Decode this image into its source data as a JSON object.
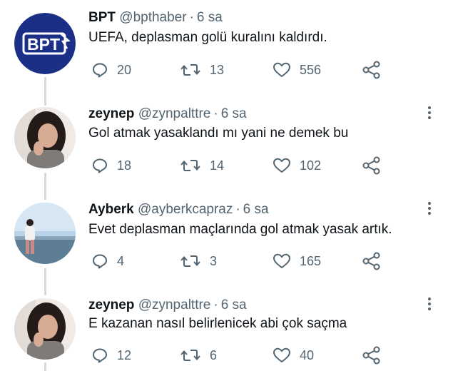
{
  "tweets": [
    {
      "name": "BPT",
      "handle": "@bpthaber",
      "dot": "·",
      "time": "6 sa",
      "text": "UEFA, deplasman golü kuralını kaldırdı.",
      "avatar_label": "BPT",
      "replies": "20",
      "retweets": "13",
      "likes": "556",
      "show_more": false
    },
    {
      "name": "zeynep",
      "handle": "@zynpalttre",
      "dot": "·",
      "time": "6 sa",
      "text": "Gol atmak yasaklandı mı yani ne demek bu",
      "replies": "18",
      "retweets": "14",
      "likes": "102",
      "show_more": true
    },
    {
      "name": "Ayberk",
      "handle": "@ayberkcapraz",
      "dot": "·",
      "time": "6 sa",
      "text": "Evet deplasman maçlarında gol atmak yasak artık.",
      "replies": "4",
      "retweets": "3",
      "likes": "165",
      "show_more": true
    },
    {
      "name": "zeynep",
      "handle": "@zynpalttre",
      "dot": "·",
      "time": "6 sa",
      "text": "E kazanan nasıl belirlenicek abi çok saçma",
      "replies": "12",
      "retweets": "6",
      "likes": "40",
      "show_more": true
    }
  ],
  "icons": {
    "reply": "reply-icon",
    "retweet": "retweet-icon",
    "like": "heart-icon",
    "share": "share-icon",
    "more": "more-options-icon"
  },
  "colors": {
    "text": "#0f1419",
    "secondary": "#536471",
    "thread_line": "#cfd9de",
    "bpt_brand": "#1c2f86"
  }
}
